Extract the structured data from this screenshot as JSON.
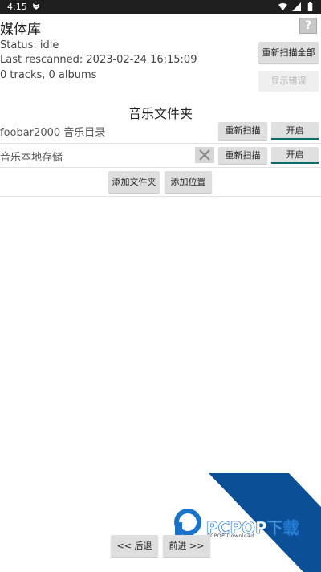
{
  "status_bar": {
    "time": "4:15"
  },
  "header": {
    "title": "媒体库",
    "help_label": "?"
  },
  "library": {
    "status": "Status: idle",
    "last_rescanned": "Last rescanned: 2023-02-24 16:15:09",
    "counts": "0 tracks, 0 albums",
    "rescan_all_label": "重新扫描全部",
    "show_errors_label": "显示错误"
  },
  "folders": {
    "section_title": "音乐文件夹",
    "items": [
      {
        "name": "foobar2000 音乐目录",
        "rescan_label": "重新扫描",
        "toggle_label": "开启"
      },
      {
        "name": "音乐本地存储",
        "rescan_label": "重新扫描",
        "toggle_label": "开启"
      }
    ],
    "add_folder_label": "添加文件夹",
    "add_location_label": "添加位置"
  },
  "navigation": {
    "back_label": "<< 后退",
    "forward_label": "前进 >>"
  },
  "watermark": {
    "text": "PCPOP下载",
    "sub": "PCPOP Download"
  }
}
